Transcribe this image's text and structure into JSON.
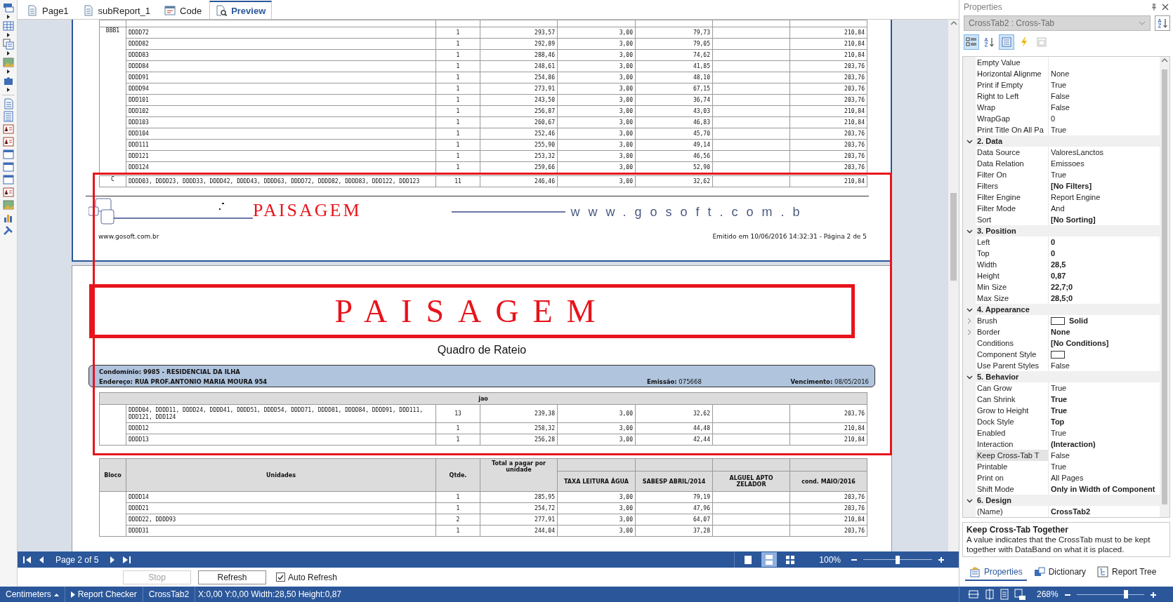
{
  "tabs": [
    {
      "label": "Page1",
      "kind": "page",
      "selected": false
    },
    {
      "label": "subReport_1",
      "kind": "page",
      "selected": false
    },
    {
      "label": "Code",
      "kind": "code",
      "selected": false
    },
    {
      "label": "Preview",
      "kind": "preview",
      "selected": true
    }
  ],
  "report": {
    "upper_groups": [
      {
        "bloco": "BBB1",
        "rows": [
          {
            "units": "DDDD72",
            "qty": "1",
            "total": "293,57",
            "taxa": "3,00",
            "sabesp": "79,73",
            "cond": "210,84"
          },
          {
            "units": "DDDD82",
            "qty": "1",
            "total": "292,89",
            "taxa": "3,00",
            "sabesp": "79,05",
            "cond": "210,84"
          },
          {
            "units": "DDDD83",
            "qty": "1",
            "total": "288,46",
            "taxa": "3,00",
            "sabesp": "74,62",
            "cond": "210,84"
          },
          {
            "units": "DDDD84",
            "qty": "1",
            "total": "248,61",
            "taxa": "3,00",
            "sabesp": "41,85",
            "cond": "203,76"
          },
          {
            "units": "DDDD91",
            "qty": "1",
            "total": "254,86",
            "taxa": "3,00",
            "sabesp": "48,10",
            "cond": "203,76"
          },
          {
            "units": "DDDD94",
            "qty": "1",
            "total": "273,91",
            "taxa": "3,00",
            "sabesp": "67,15",
            "cond": "203,76"
          },
          {
            "units": "DDD101",
            "qty": "1",
            "total": "243,50",
            "taxa": "3,00",
            "sabesp": "36,74",
            "cond": "203,76"
          },
          {
            "units": "DDD102",
            "qty": "1",
            "total": "256,87",
            "taxa": "3,00",
            "sabesp": "43,03",
            "cond": "210,84"
          },
          {
            "units": "DDD103",
            "qty": "1",
            "total": "260,67",
            "taxa": "3,00",
            "sabesp": "46,83",
            "cond": "210,84"
          },
          {
            "units": "DDD104",
            "qty": "1",
            "total": "252,46",
            "taxa": "3,00",
            "sabesp": "45,70",
            "cond": "203,76"
          },
          {
            "units": "DDD111",
            "qty": "1",
            "total": "255,90",
            "taxa": "3,00",
            "sabesp": "49,14",
            "cond": "203,76"
          },
          {
            "units": "DDD121",
            "qty": "1",
            "total": "253,32",
            "taxa": "3,00",
            "sabesp": "46,56",
            "cond": "203,76"
          },
          {
            "units": "DDD124",
            "qty": "1",
            "total": "259,66",
            "taxa": "3,00",
            "sabesp": "52,90",
            "cond": "203,76"
          }
        ]
      },
      {
        "bloco": "C",
        "rows": [
          {
            "units": "DDDD03, DDDD23, DDDD33, DDDD42, DDDD43, DDDD63, DDDD72, DDDD82, DDDD83, DDD122, DDD123",
            "qty": "11",
            "total": "246,46",
            "taxa": "3,00",
            "sabesp": "32,62",
            "cond": "210,84"
          }
        ]
      }
    ],
    "footer": {
      "brand": "PAISAGEM",
      "banner": "www.gosoft.com.b",
      "website": "www.gosoft.com.br",
      "issued": "Emitido em 10/06/2016 14:32:31 - Página 2 de 5"
    },
    "title": "PAISAGEM",
    "subtitle": "Quadro de Rateio",
    "info": {
      "condominio": "Condomínio: 9985 - RESIDENCIAL DA ILHA",
      "endereco": "Endereço: RUA PROF.ANTONIO MARIA MOURA 954",
      "emissao": "**Emissão:** 075668",
      "vencimento": "**Vencimento:** 08/05/2016"
    },
    "crosstab": {
      "title": "jao",
      "rows": [
        {
          "units": "DDDD04, DDDD11, DDDD24, DDDD41, DDDD51, DDDD54, DDDD71, DDDD81, DDDD84, DDDD91, DDD111, DDD121, DDD124",
          "qty": "13",
          "total": "239,38",
          "taxa": "3,00",
          "sabesp": "32,62",
          "cond": "203,76"
        },
        {
          "units": "DDDD12",
          "qty": "1",
          "total": "258,32",
          "taxa": "3,00",
          "sabesp": "44,48",
          "cond": "210,84"
        },
        {
          "units": "DDDD13",
          "qty": "1",
          "total": "256,28",
          "taxa": "3,00",
          "sabesp": "42,44",
          "cond": "210,84"
        }
      ]
    },
    "lower_table": {
      "columns": [
        "Bloco",
        "Unidades",
        "Qtde.",
        "Total a pagar por unidade",
        "TAXA LEITURA ÁGUA",
        "SABESP ABRIL/2014",
        "ALGUEL APTO ZELADOR",
        "cond. MAIO/2016"
      ],
      "rows": [
        {
          "units": "DDDD14",
          "qty": "1",
          "total": "285,95",
          "taxa": "3,00",
          "sabesp": "79,19",
          "cond": "203,76"
        },
        {
          "units": "DDDD21",
          "qty": "1",
          "total": "254,72",
          "taxa": "3,00",
          "sabesp": "47,96",
          "cond": "203,76"
        },
        {
          "units": "DDDD22, DDDD93",
          "qty": "2",
          "total": "277,91",
          "taxa": "3,00",
          "sabesp": "64,07",
          "cond": "210,84"
        },
        {
          "units": "DDDD31",
          "qty": "1",
          "total": "244,04",
          "taxa": "3,00",
          "sabesp": "37,28",
          "cond": "203,76"
        }
      ]
    }
  },
  "navigation": {
    "page": "Page 2 of 5",
    "view_modes": [
      {
        "kind": "single",
        "selected": false
      },
      {
        "kind": "continuous",
        "selected": true
      },
      {
        "kind": "multiple",
        "selected": false
      }
    ],
    "zoom": "100%",
    "zoom_slider": {
      "level": 0.5
    }
  },
  "actions": {
    "stop": {
      "label": "Stop",
      "disabled": true
    },
    "refresh": {
      "label": "Refresh",
      "disabled": false
    },
    "auto_refresh": {
      "label": "Auto Refresh",
      "checked": true
    }
  },
  "properties": {
    "title": "Properties",
    "object": "CrossTab2 : Cross-Tab",
    "toolbar": [
      {
        "kind": "categorized",
        "selected": true,
        "disabled": false
      },
      {
        "kind": "alphabetical",
        "selected": false,
        "disabled": false
      },
      {
        "kind": "properties",
        "selected": true,
        "disabled": false
      },
      {
        "kind": "events",
        "selected": false,
        "disabled": false
      },
      {
        "kind": "other",
        "selected": false,
        "disabled": true
      }
    ],
    "grid": [
      {
        "kind": "property",
        "name": "Empty Value",
        "selected": false,
        "expandable": false
      },
      {
        "kind": "property",
        "name": "Horizontal Alignme",
        "value": "None",
        "bold": false,
        "selected": false,
        "expandable": false
      },
      {
        "kind": "property",
        "name": "Print if Empty",
        "value": "True",
        "bold": false,
        "selected": false,
        "expandable": false
      },
      {
        "kind": "property",
        "name": "Right to Left",
        "value": "False",
        "bold": false,
        "selected": false,
        "expandable": false
      },
      {
        "kind": "property",
        "name": "Wrap",
        "value": "False",
        "bold": false,
        "selected": false,
        "expandable": false
      },
      {
        "kind": "property",
        "name": "WrapGap",
        "value": "0",
        "bold": false,
        "selected": false,
        "expandable": false
      },
      {
        "kind": "property",
        "name": "Print Title On All Pa",
        "value": "True",
        "bold": false,
        "selected": false,
        "expandable": false
      },
      {
        "kind": "category",
        "label": "2. Data",
        "expanded": true
      },
      {
        "kind": "property",
        "name": "Data Source",
        "value": "ValoresLanctos",
        "bold": false,
        "selected": false,
        "expandable": false
      },
      {
        "kind": "property",
        "name": "Data Relation",
        "value": "Emissoes",
        "bold": false,
        "selected": false,
        "expandable": false
      },
      {
        "kind": "property",
        "name": "Filter On",
        "value": "True",
        "bold": false,
        "selected": false,
        "expandable": false
      },
      {
        "kind": "property",
        "name": "Filters",
        "value": "[No Filters]",
        "bold": true,
        "selected": false,
        "expandable": false
      },
      {
        "kind": "property",
        "name": "Filter Engine",
        "value": "Report Engine",
        "bold": false,
        "selected": false,
        "expandable": false
      },
      {
        "kind": "property",
        "name": "Filter Mode",
        "value": "And",
        "bold": false,
        "selected": false,
        "expandable": false
      },
      {
        "kind": "property",
        "name": "Sort",
        "value": "[No Sorting]",
        "bold": true,
        "selected": false,
        "expandable": false
      },
      {
        "kind": "category",
        "label": "3. Position",
        "expanded": true
      },
      {
        "kind": "property",
        "name": "Left",
        "value": "0",
        "bold": true,
        "selected": false,
        "expandable": false
      },
      {
        "kind": "property",
        "name": "Top",
        "value": "0",
        "bold": true,
        "selected": false,
        "expandable": false
      },
      {
        "kind": "property",
        "name": "Width",
        "value": "28,5",
        "bold": true,
        "selected": false,
        "expandable": false
      },
      {
        "kind": "property",
        "name": "Height",
        "value": "0,87",
        "bold": true,
        "selected": false,
        "expandable": false
      },
      {
        "kind": "property",
        "name": "Min Size",
        "value": "22,7;0",
        "bold": true,
        "selected": false,
        "expandable": false
      },
      {
        "kind": "property",
        "name": "Max Size",
        "value": "28,5;0",
        "bold": true,
        "selected": false,
        "expandable": false
      },
      {
        "kind": "category",
        "label": "4. Appearance",
        "expanded": true
      },
      {
        "kind": "swatch",
        "name": "Brush",
        "value": "Solid",
        "bold": true,
        "selected": false,
        "expandable": true
      },
      {
        "kind": "property",
        "name": "Border",
        "value": "None",
        "bold": true,
        "selected": false,
        "expandable": true
      },
      {
        "kind": "property",
        "name": "Conditions",
        "value": "[No Conditions]",
        "bold": true,
        "selected": false,
        "expandable": false
      },
      {
        "kind": "swatch",
        "name": "Component Style",
        "selected": false,
        "expandable": false
      },
      {
        "kind": "property",
        "name": "Use Parent Styles",
        "value": "False",
        "bold": false,
        "selected": false,
        "expandable": false
      },
      {
        "kind": "category",
        "label": "5. Behavior",
        "expanded": true
      },
      {
        "kind": "property",
        "name": "Can Grow",
        "value": "True",
        "bold": false,
        "selected": false,
        "expandable": false
      },
      {
        "kind": "property",
        "name": "Can Shrink",
        "value": "True",
        "bold": true,
        "selected": false,
        "expandable": false
      },
      {
        "kind": "property",
        "name": "Grow to Height",
        "value": "True",
        "bold": true,
        "selected": false,
        "expandable": false
      },
      {
        "kind": "property",
        "name": "Dock Style",
        "value": "Top",
        "bold": true,
        "selected": false,
        "expandable": false
      },
      {
        "kind": "property",
        "name": "Enabled",
        "value": "True",
        "bold": false,
        "selected": false,
        "expandable": false
      },
      {
        "kind": "property",
        "name": "Interaction",
        "value": "(Interaction)",
        "bold": true,
        "selected": false,
        "expandable": false
      },
      {
        "kind": "property",
        "name": "Keep Cross-Tab T",
        "value": "False",
        "bold": false,
        "selected": true,
        "expandable": false
      },
      {
        "kind": "property",
        "name": "Printable",
        "value": "True",
        "bold": false,
        "selected": false,
        "expandable": false
      },
      {
        "kind": "property",
        "name": "Print on",
        "value": "All Pages",
        "bold": false,
        "selected": false,
        "expandable": false
      },
      {
        "kind": "property",
        "name": "Shift Mode",
        "value": "Only in Width of Component",
        "bold": true,
        "selected": false,
        "expandable": false
      },
      {
        "kind": "category",
        "label": "6. Design",
        "expanded": true
      },
      {
        "kind": "property",
        "name": "(Name)",
        "value": "CrossTab2",
        "bold": true,
        "selected": false,
        "expandable": false
      }
    ],
    "description": {
      "title": "Keep Cross-Tab Together",
      "text": "A value indicates that the CrossTab must to be kept together with DataBand on what it is placed."
    },
    "tabs": [
      {
        "label": "Properties",
        "kind": "properties",
        "selected": true
      },
      {
        "label": "Dictionary",
        "kind": "dictionary",
        "selected": false
      },
      {
        "label": "Report Tree",
        "kind": "tree",
        "selected": false
      }
    ]
  },
  "status": {
    "unit": "Centimeters",
    "checker": "Report Checker",
    "component": "CrossTab2",
    "position": "X:0,00 Y:0,00 Width:28,50 Height:0,87",
    "zoom": "268%",
    "zoom_slider": {
      "level": 0.73
    }
  }
}
